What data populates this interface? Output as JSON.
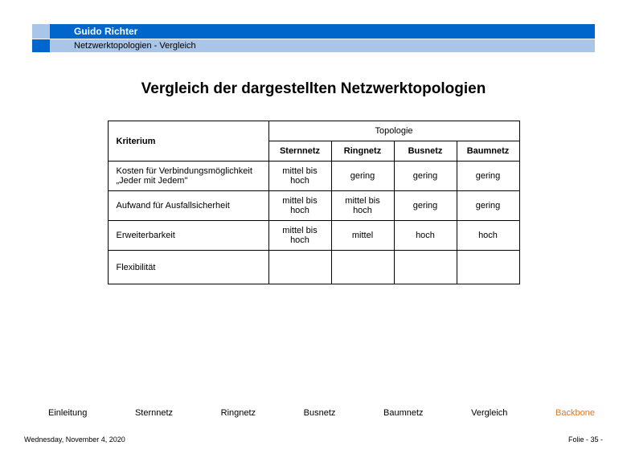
{
  "header": {
    "author": "Guido Richter",
    "subtitle": "Netzwerktopologien  - Vergleich"
  },
  "main": {
    "title": "Vergleich der dargestellten Netzwerktopologien"
  },
  "chart_data": {
    "type": "table",
    "criterion_header": "Kriterium",
    "group_header": "Topologie",
    "columns": [
      "Sternnetz",
      "Ringnetz",
      "Busnetz",
      "Baumnetz"
    ],
    "rows": [
      {
        "label": "Kosten für Verbindungsmöglichkeit „Jeder mit Jedem\"",
        "values": [
          "mittel bis hoch",
          "gering",
          "gering",
          "gering"
        ]
      },
      {
        "label": "Aufwand für Ausfallsicherheit",
        "values": [
          "mittel bis hoch",
          "mittel bis hoch",
          "gering",
          "gering"
        ]
      },
      {
        "label": "Erweiterbarkeit",
        "values": [
          "mittel bis hoch",
          "mittel",
          "hoch",
          "hoch"
        ]
      },
      {
        "label": "Flexibilität",
        "values": [
          "",
          "",
          "",
          ""
        ]
      }
    ]
  },
  "nav": {
    "items": [
      "Einleitung",
      "Sternnetz",
      "Ringnetz",
      "Busnetz",
      "Baumnetz",
      "Vergleich",
      "Backbone"
    ],
    "active_index": 6
  },
  "footer": {
    "date": "Wednesday, November 4, 2020",
    "slide_prefix": "Folie - ",
    "slide_number": "35",
    "slide_suffix": " -"
  }
}
